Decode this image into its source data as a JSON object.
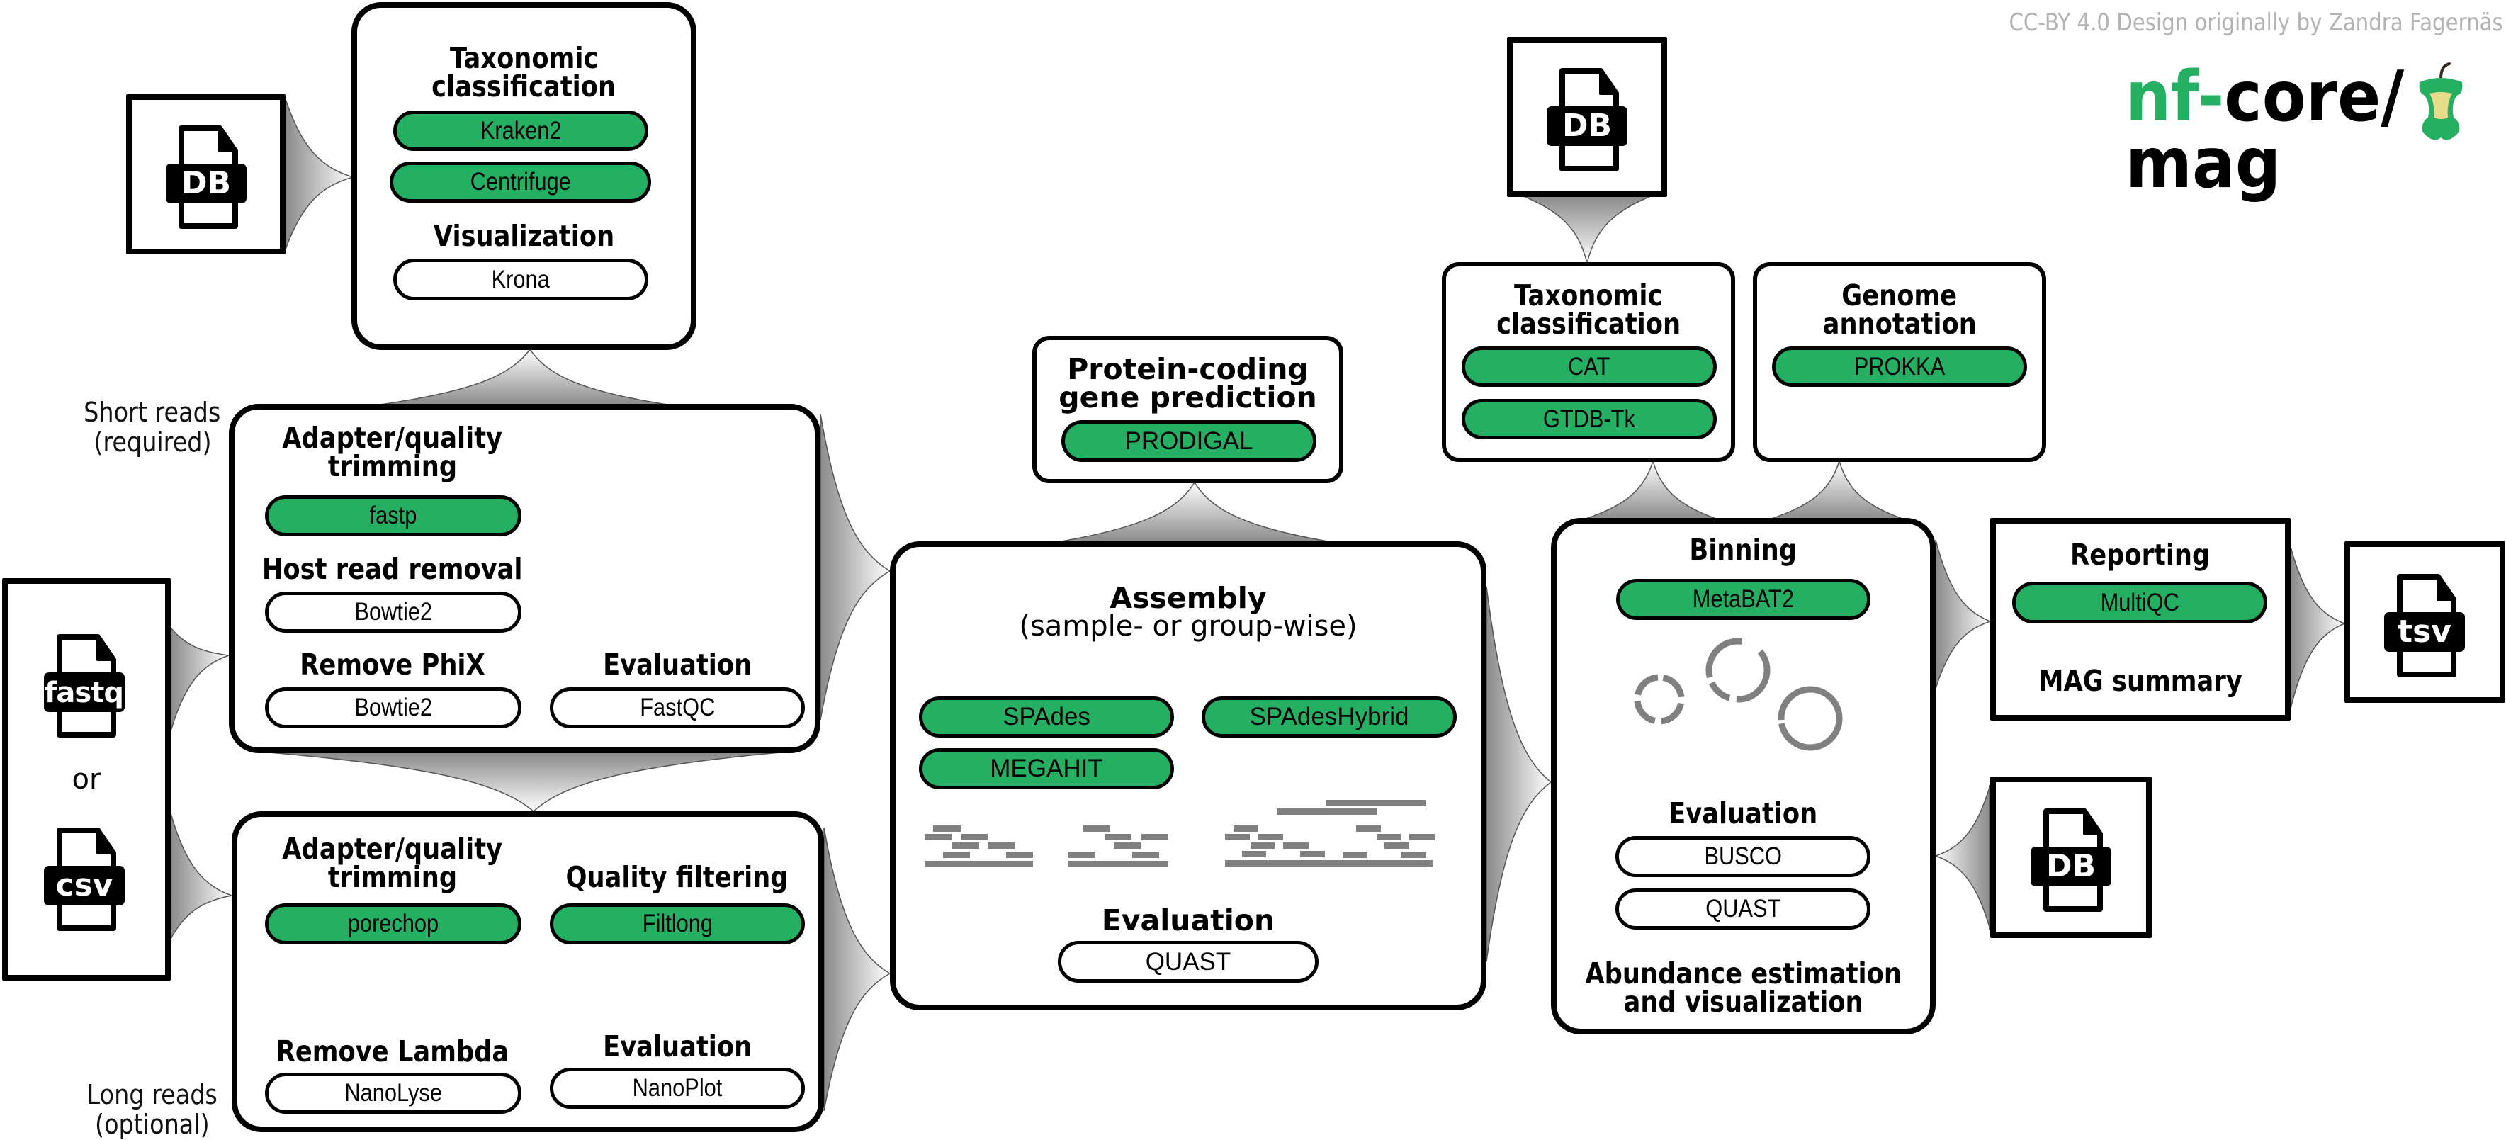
{
  "copyright": "CC-BY 4.0 Design originally by Zandra Fagernäs",
  "logo": {
    "prefix": "nf-",
    "core": "core/",
    "pipeline": "mag",
    "icon": "apple-core-icon"
  },
  "colors": {
    "tool_green": "#24AF63",
    "logo_green": "#24AF63",
    "connector_dark": "#8a8a8a",
    "connector_light": "#ffffff",
    "read_gray": "#808080",
    "copyright_gray": "#b3b3b3",
    "apple_flesh": "#E8DC8A",
    "apple_stem": "#3a2a22"
  },
  "inputs": {
    "db_top_left": {
      "label": "DB",
      "icon": "database-file-icon"
    },
    "reads": {
      "fastq_label": "fastq",
      "or_label": "or",
      "csv_label": "csv",
      "icon": "file-icon"
    },
    "db_top_right": {
      "label": "DB",
      "icon": "database-file-icon"
    },
    "db_bottom_right": {
      "label": "DB",
      "icon": "database-file-icon"
    }
  },
  "read_labels": {
    "short": [
      "Short reads",
      "(required)"
    ],
    "long": [
      "Long reads",
      "(optional)"
    ]
  },
  "read_taxonomy": {
    "title": [
      "Taxonomic",
      "classification"
    ],
    "tools": [
      {
        "name": "Kraken2",
        "required": true
      },
      {
        "name": "Centrifuge",
        "required": true
      }
    ],
    "viz_title": "Visualization",
    "viz_tools": [
      {
        "name": "Krona",
        "required": false
      }
    ]
  },
  "short_reads": {
    "trim_title": [
      "Adapter/quality",
      "trimming"
    ],
    "trim_tool": {
      "name": "fastp",
      "required": true
    },
    "host_title": "Host read removal",
    "host_tool": {
      "name": "Bowtie2",
      "required": false
    },
    "phix_title": "Remove PhiX",
    "phix_tool": {
      "name": "Bowtie2",
      "required": false
    },
    "eval_title": "Evaluation",
    "eval_tool": {
      "name": "FastQC",
      "required": false
    }
  },
  "long_reads": {
    "trim_title": [
      "Adapter/quality",
      "trimming"
    ],
    "trim_tool": {
      "name": "porechop",
      "required": true
    },
    "filter_title": "Quality filtering",
    "filter_tool": {
      "name": "Filtlong",
      "required": true
    },
    "lambda_title": "Remove Lambda",
    "lambda_tool": {
      "name": "NanoLyse",
      "required": false
    },
    "eval_title": "Evaluation",
    "eval_tool": {
      "name": "NanoPlot",
      "required": false
    }
  },
  "protein": {
    "title": [
      "Protein-coding",
      "gene prediction"
    ],
    "tool": {
      "name": "PRODIGAL",
      "required": true
    }
  },
  "assembly": {
    "title": "Assembly",
    "subtitle": "(sample- or group-wise)",
    "tools": [
      {
        "name": "SPAdes",
        "required": true
      },
      {
        "name": "SPAdesHybrid",
        "required": true
      },
      {
        "name": "MEGAHIT",
        "required": true
      }
    ],
    "eval_title": "Evaluation",
    "eval_tool": {
      "name": "QUAST",
      "required": false
    },
    "illustration": "overlapping-reads-icon"
  },
  "bin_taxonomy": {
    "title": [
      "Taxonomic",
      "classification"
    ],
    "tools": [
      {
        "name": "CAT",
        "required": true
      },
      {
        "name": "GTDB-Tk",
        "required": true
      }
    ]
  },
  "genome_annotation": {
    "title": [
      "Genome",
      "annotation"
    ],
    "tool": {
      "name": "PROKKA",
      "required": true
    }
  },
  "binning": {
    "title": "Binning",
    "tool": {
      "name": "MetaBAT2",
      "required": true
    },
    "illustration": "genome-bins-icon",
    "eval_title": "Evaluation",
    "eval_tools": [
      {
        "name": "BUSCO",
        "required": false
      },
      {
        "name": "QUAST",
        "required": false
      }
    ],
    "abundance_title": [
      "Abundance estimation",
      "and visualization"
    ]
  },
  "reporting": {
    "title": "Reporting",
    "tool": {
      "name": "MultiQC",
      "required": true
    },
    "summary": "MAG summary"
  },
  "output": {
    "label": "tsv",
    "icon": "tsv-file-icon"
  }
}
